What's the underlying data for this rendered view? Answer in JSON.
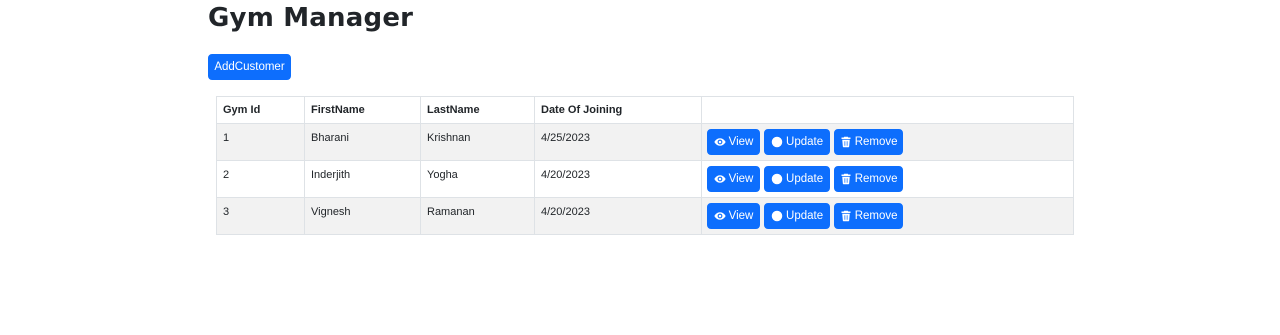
{
  "page": {
    "title": "Gym Manager"
  },
  "toolbar": {
    "add_label": "AddCustomer"
  },
  "table": {
    "headers": {
      "id": "Gym Id",
      "first": "FirstName",
      "last": "LastName",
      "date": "Date Of Joining",
      "actions": ""
    },
    "rows": [
      {
        "id": "1",
        "first": "Bharani",
        "last": "Krishnan",
        "date": "4/25/2023"
      },
      {
        "id": "2",
        "first": "Inderjith",
        "last": "Yogha",
        "date": "4/20/2023"
      },
      {
        "id": "3",
        "first": "Vignesh",
        "last": "Ramanan",
        "date": "4/20/2023"
      }
    ],
    "actions": {
      "view": "View",
      "update": "Update",
      "remove": "Remove"
    }
  },
  "colors": {
    "primary": "#0d6efd",
    "stripe": "#f2f2f2",
    "border": "#dee2e6"
  },
  "icons": {
    "view": "eye-icon",
    "update": "arrow-up-circle-icon",
    "remove": "trash-icon"
  }
}
